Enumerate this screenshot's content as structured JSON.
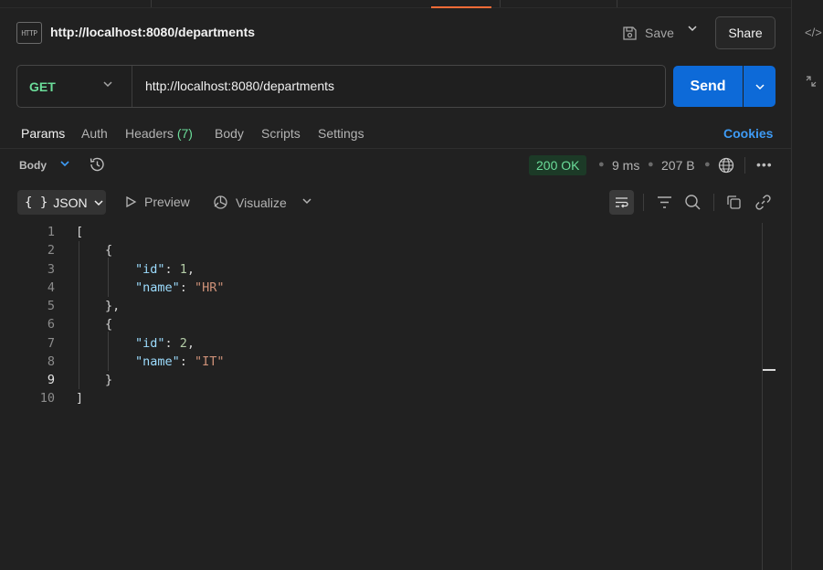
{
  "header": {
    "request_icon_label": "HTTP",
    "title": "http://localhost:8080/departments",
    "save_label": "Save",
    "share_label": "Share"
  },
  "request": {
    "method": "GET",
    "url": "http://localhost:8080/departments",
    "send_label": "Send"
  },
  "request_tabs": {
    "params": "Params",
    "auth": "Auth",
    "headers": "Headers",
    "headers_count": "(7)",
    "body": "Body",
    "scripts": "Scripts",
    "settings": "Settings",
    "cookies": "Cookies"
  },
  "response": {
    "body_label": "Body",
    "status": "200 OK",
    "time": "9 ms",
    "size": "207 B",
    "format_label": "JSON",
    "format_icon": "{ }",
    "preview_label": "Preview",
    "visualize_label": "Visualize"
  },
  "code": {
    "line_numbers": [
      "1",
      "2",
      "3",
      "4",
      "5",
      "6",
      "7",
      "8",
      "9",
      "10"
    ],
    "open_bracket": "[",
    "close_bracket": "]",
    "open_brace": "{",
    "close_brace": "}",
    "close_brace_comma": "},",
    "items": [
      {
        "id_key": "\"id\"",
        "id_value": "1",
        "name_key": "\"name\"",
        "name_value": "\"HR\""
      },
      {
        "id_key": "\"id\"",
        "id_value": "2",
        "name_key": "\"name\"",
        "name_value": "\"IT\""
      }
    ]
  },
  "colors": {
    "accent_blue": "#0d6ad8",
    "status_green": "#6bdd9a",
    "tab_accent": "#ff6c37",
    "link_blue": "#3e9bf5"
  },
  "icons": {
    "save": "save-icon",
    "history": "history-icon",
    "globe": "globe-icon",
    "more": "more-icon",
    "preview": "play-icon",
    "visualize": "visualize-icon",
    "wrap": "wrap-lines-icon",
    "filter": "filter-icon",
    "search": "search-icon",
    "copy": "copy-icon",
    "link": "link-icon",
    "code": "code-icon",
    "collapse": "collapse-icon"
  }
}
